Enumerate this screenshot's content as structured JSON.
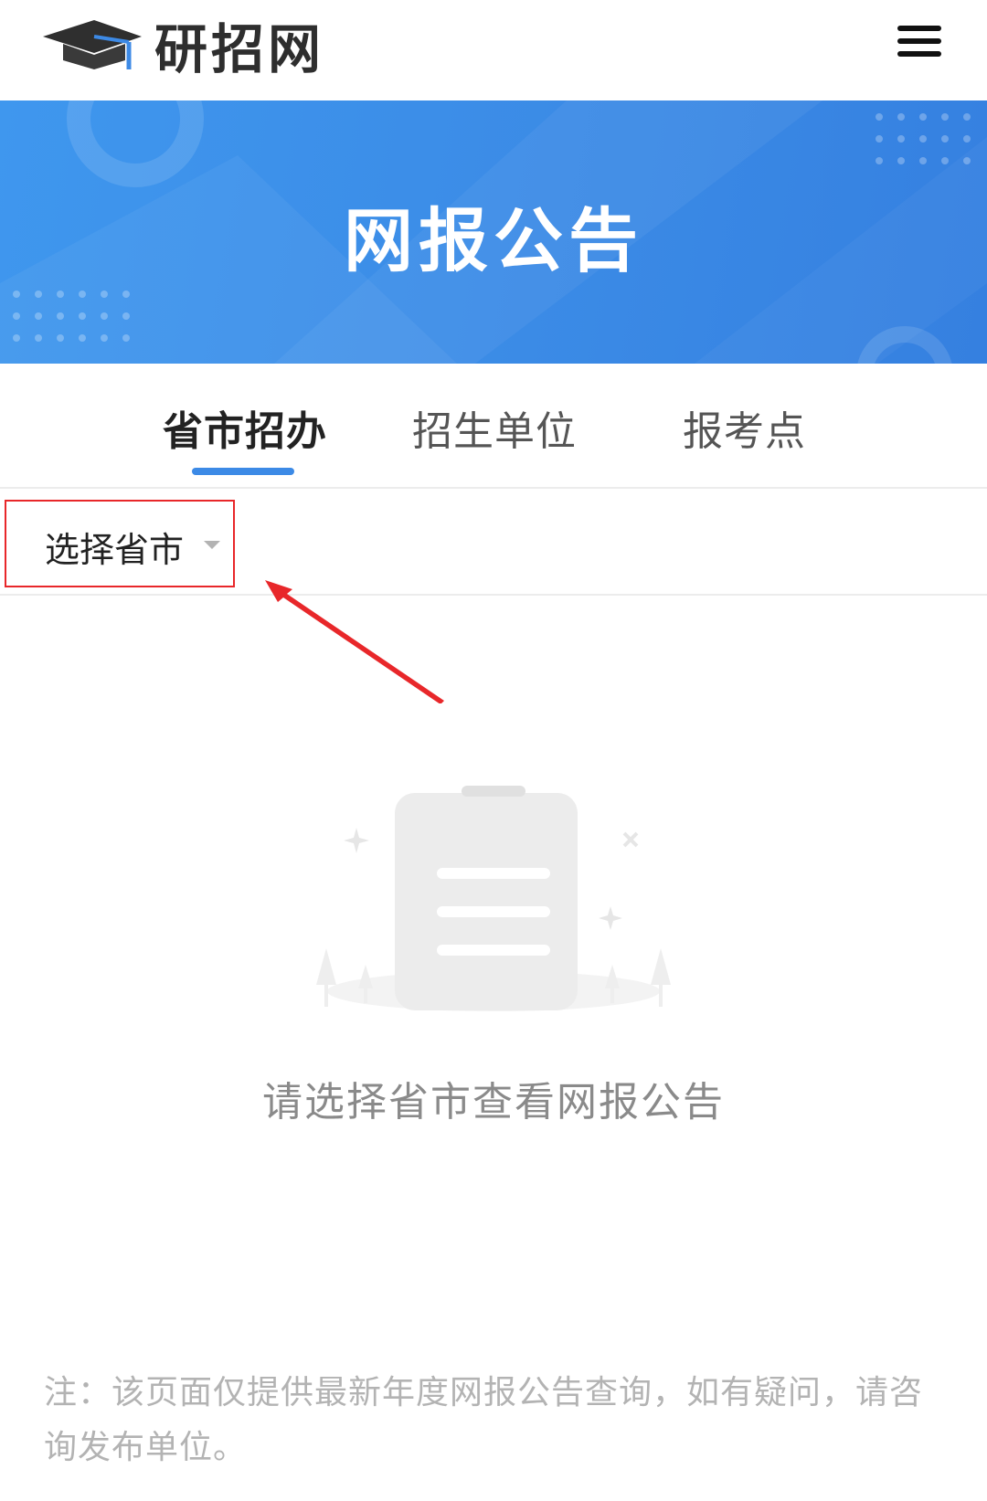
{
  "header": {
    "logo_text": "研招网",
    "logo_icon": "graduation-cap-icon",
    "menu_icon": "hamburger-menu-icon"
  },
  "banner": {
    "title": "网报公告"
  },
  "tabs": [
    {
      "label": "省市招办",
      "active": true
    },
    {
      "label": "招生单位",
      "active": false
    },
    {
      "label": "报考点",
      "active": false
    }
  ],
  "filter": {
    "province_select_label": "选择省市",
    "dropdown_icon": "caret-down-icon"
  },
  "empty_state": {
    "icon": "empty-document-icon",
    "message": "请选择省市查看网报公告"
  },
  "footer": {
    "note": "注：该页面仅提供最新年度网报公告查询，如有疑问，请咨询发布单位。"
  },
  "colors": {
    "brand_blue": "#3c8ae6",
    "annotation_red": "#e8272a"
  }
}
